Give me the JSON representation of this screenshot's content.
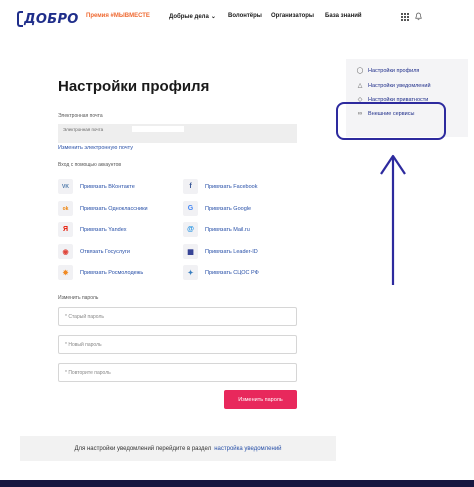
{
  "header": {
    "logo_text": "ДОБРО",
    "prize_label": "Премия #МЫВМЕСТЕ",
    "nav": [
      {
        "label": "Добрые дела",
        "has_chevron": true
      },
      {
        "label": "Волонтёры"
      },
      {
        "label": "Организаторы"
      },
      {
        "label": "База знаний"
      }
    ],
    "icons": [
      "apps-grid-icon",
      "bell-icon"
    ]
  },
  "page": {
    "title": "Настройки профиля",
    "email_label": "Электронная почта",
    "email_inner_label": "Электронная почта",
    "change_email_link": "Изменить электронную почту",
    "accounts_label": "Вход с помощью аккаунтов",
    "services_left": [
      {
        "icon": "vk-icon",
        "glyph": "VK",
        "color": "#4a76a8",
        "label": "Привязать ВКонтакте"
      },
      {
        "icon": "odnoklassniki-icon",
        "glyph": "ok",
        "color": "#ee8208",
        "label": "Привязать Одноклассники"
      },
      {
        "icon": "yandex-icon",
        "glyph": "Я",
        "color": "#e61400",
        "label": "Привязать Yandex"
      },
      {
        "icon": "gosuslugi-icon",
        "glyph": "◉",
        "color": "#e0463c",
        "label": "Отвязать Госуслуги"
      },
      {
        "icon": "rosmolodezh-icon",
        "glyph": "✸",
        "color": "#f08a24",
        "label": "Привязать Росмолодежь"
      }
    ],
    "services_right": [
      {
        "icon": "facebook-icon",
        "glyph": "f",
        "color": "#3b5998",
        "label": "Привязать Facebook"
      },
      {
        "icon": "google-icon",
        "glyph": "G",
        "color": "#4285f4",
        "label": "Привязать Google"
      },
      {
        "icon": "mailru-icon",
        "glyph": "@",
        "color": "#168de2",
        "label": "Привязать Mail.ru"
      },
      {
        "icon": "leader-id-icon",
        "glyph": "▦",
        "color": "#1f2e8a",
        "label": "Привязать Leader-ID"
      },
      {
        "icon": "sdos-icon",
        "glyph": "✦",
        "color": "#3a7fc1",
        "label": "Привязать СЦОС РФ"
      }
    ],
    "password_label": "Изменить пароль",
    "old_password_placeholder": "* Старый пароль",
    "new_password_placeholder": "* Новый пароль",
    "repeat_password_placeholder": "* Повторите пароль",
    "change_password_button": "Изменить пароль",
    "footer_text": "Для настройки уведомлений перейдите в раздел",
    "footer_link": "настройка уведомлений"
  },
  "side_menu": {
    "items": [
      {
        "icon": "user-icon",
        "glyph": "👤",
        "label": "Настройки профиля"
      },
      {
        "icon": "bell-icon",
        "glyph": "🔔",
        "label": "Настройки уведомлений"
      },
      {
        "icon": "shield-icon",
        "glyph": "⛨",
        "label": "Настройки приватности"
      },
      {
        "icon": "link-icon",
        "glyph": "🔗",
        "label": "Внешние сервисы"
      }
    ]
  },
  "colors": {
    "brand": "#1f2e8a",
    "accent": "#e8285c",
    "annotation": "#2d2a9e"
  }
}
